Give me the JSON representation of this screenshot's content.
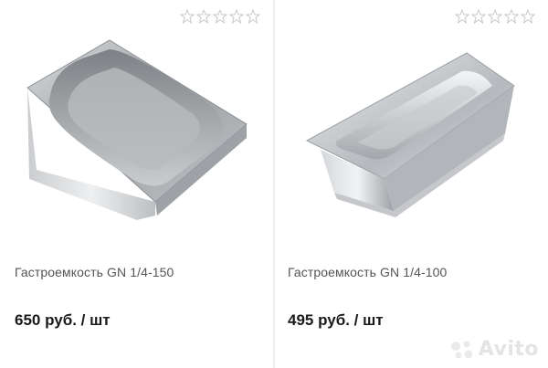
{
  "products": [
    {
      "name": "Гастроемкость GN 1/4-150",
      "price": "650 руб. / шт",
      "rating_stars": 0,
      "image_icon": "stainless-gastronorm-pan-deep"
    },
    {
      "name": "Гастроемкость GN 1/4-100",
      "price": "495 руб. / шт",
      "rating_stars": 0,
      "image_icon": "stainless-gastronorm-pan"
    }
  ],
  "watermark": {
    "text": "Avito"
  },
  "colors": {
    "star_outline": "#c8c8c8",
    "steel_light": "#e6e8ea",
    "steel_dark": "#8d9196",
    "divider": "#eeeeee"
  }
}
